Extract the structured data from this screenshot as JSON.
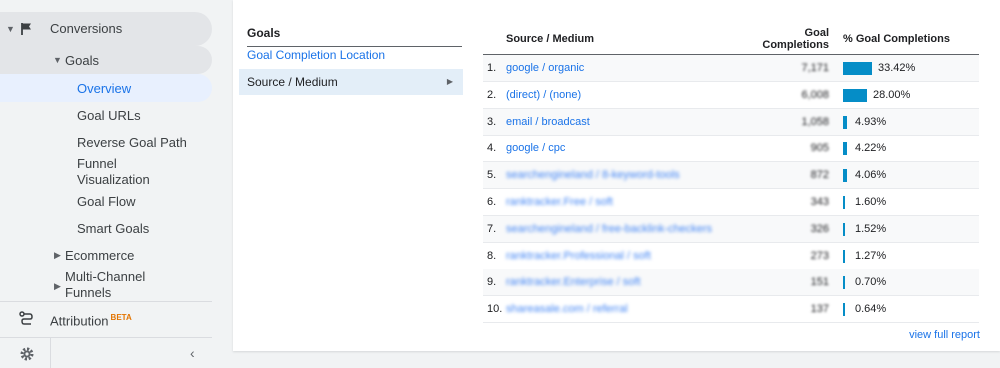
{
  "sidebar": {
    "conversions": "Conversions",
    "goals": "Goals",
    "items": [
      "Overview",
      "Goal URLs",
      "Reverse Goal Path",
      "Funnel Visualization",
      "Goal Flow",
      "Smart Goals"
    ],
    "ecommerce": "Ecommerce",
    "multichannel": "Multi-Channel Funnels",
    "attribution": "Attribution",
    "beta": "BETA"
  },
  "goals_panel": {
    "title": "Goals",
    "location": "Goal Completion Location",
    "selected": "Source / Medium"
  },
  "table": {
    "col_source": "Source / Medium",
    "col_completions": "Goal Completions",
    "col_pct": "% Goal Completions",
    "rows": [
      {
        "num": "1.",
        "source": "google / organic",
        "value": "7,171",
        "pct": "33.42%",
        "fraction": 0.3342
      },
      {
        "num": "2.",
        "source": "(direct) / (none)",
        "value": "6,008",
        "pct": "28.00%",
        "fraction": 0.28
      },
      {
        "num": "3.",
        "source": "email / broadcast",
        "value": "1,058",
        "pct": "4.93%",
        "fraction": 0.0493
      },
      {
        "num": "4.",
        "source": "google / cpc",
        "value": "905",
        "pct": "4.22%",
        "fraction": 0.0422
      },
      {
        "num": "5.",
        "source": "searchengineland / 8-keyword-tools",
        "value": "872",
        "pct": "4.06%",
        "fraction": 0.0406
      },
      {
        "num": "6.",
        "source": "ranktracker.Free / soft",
        "value": "343",
        "pct": "1.60%",
        "fraction": 0.016
      },
      {
        "num": "7.",
        "source": "searchengineland / free-backlink-checkers",
        "value": "326",
        "pct": "1.52%",
        "fraction": 0.0152
      },
      {
        "num": "8.",
        "source": "ranktracker.Professional / soft",
        "value": "273",
        "pct": "1.27%",
        "fraction": 0.0127
      },
      {
        "num": "9.",
        "source": "ranktracker.Enterprise / soft",
        "value": "151",
        "pct": "0.70%",
        "fraction": 0.007
      },
      {
        "num": "10.",
        "source": "shareasale.com / referral",
        "value": "137",
        "pct": "0.64%",
        "fraction": 0.0064
      }
    ],
    "view_full": "view full report"
  }
}
